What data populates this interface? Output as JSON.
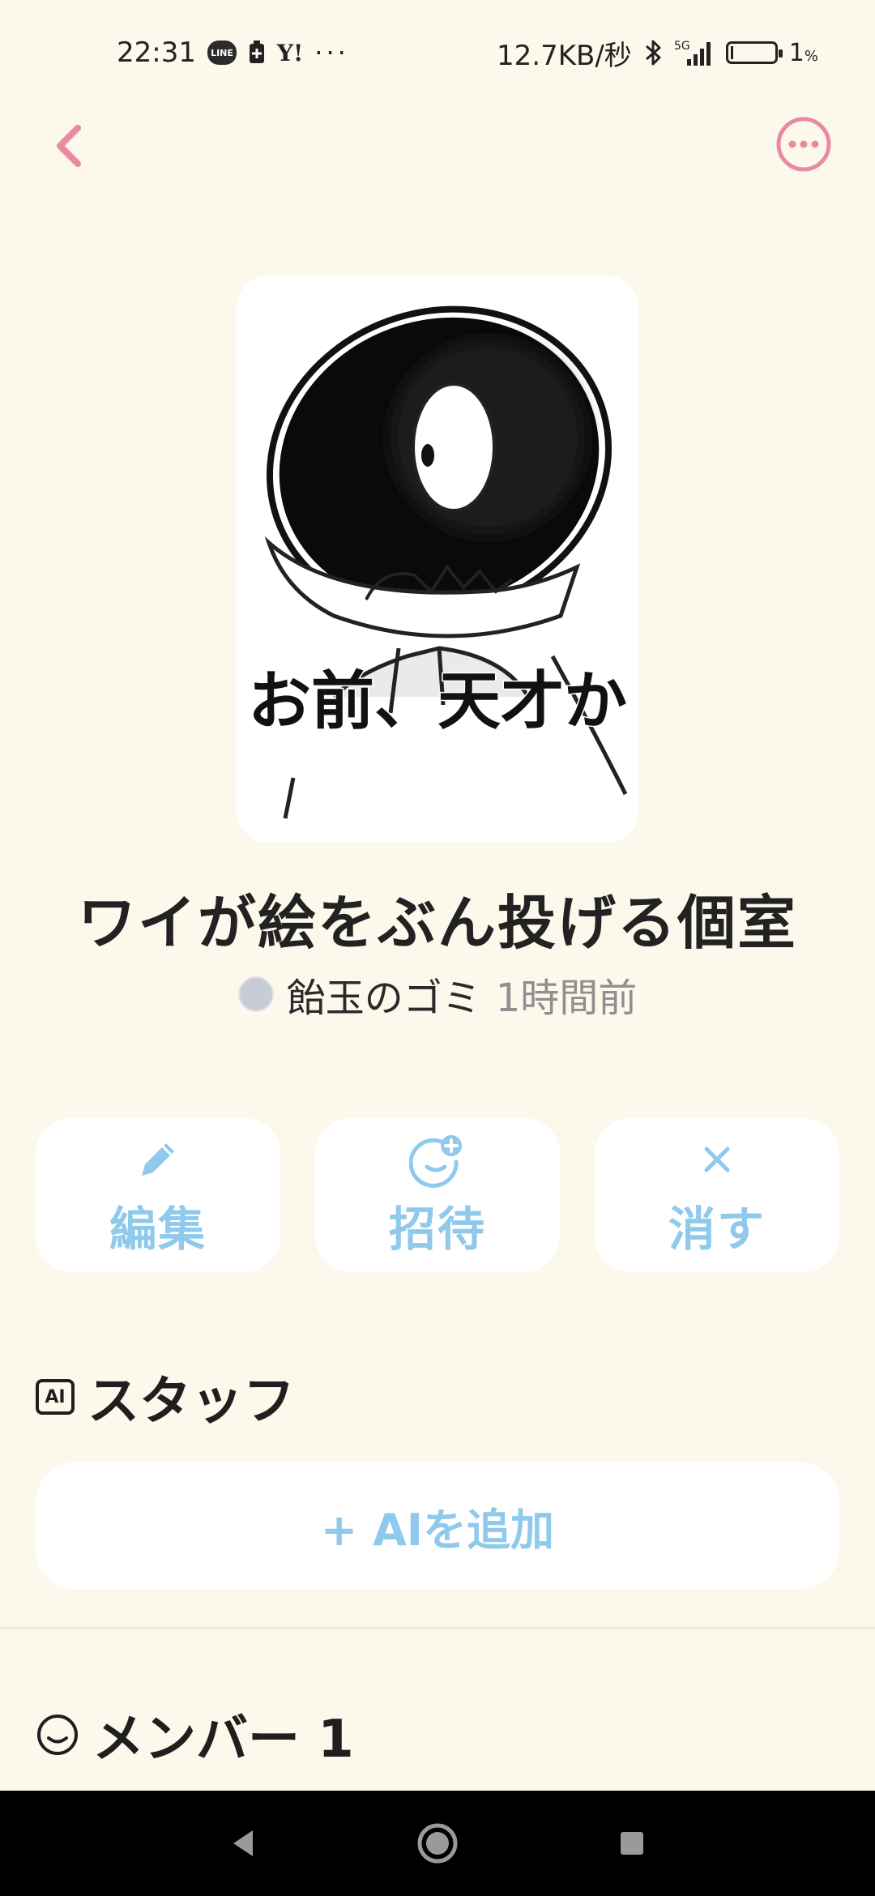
{
  "status_bar": {
    "time": "22:31",
    "line_badge": "LINE",
    "yahoo": "Y!",
    "more_dots": "···",
    "net_speed": "12.7KB/秒",
    "network": "5G",
    "battery_percent": "1",
    "battery_unit": "%",
    "battery_level": 0.01
  },
  "header": {
    "back_icon": "chevron-left-icon",
    "more_icon": "more-horizontal-icon",
    "accent_color": "#e98aa0"
  },
  "room": {
    "cover_caption": "お前、天才か",
    "title": "ワイが絵をぶん投げる個室",
    "author": "飴玉のゴミ",
    "time_ago": "1時間前"
  },
  "actions": [
    {
      "label": "編集",
      "icon": "pencil-icon"
    },
    {
      "label": "招待",
      "icon": "add-person-icon"
    },
    {
      "label": "消す",
      "icon": "close-icon"
    }
  ],
  "staff": {
    "icon_text": "AI",
    "heading": "スタッフ",
    "add_label": "+ AIを追加"
  },
  "members": {
    "heading": "メンバー 1",
    "icon": "smile-face-icon"
  },
  "colors": {
    "background": "#fdf8ec",
    "action_blue": "#8fc9ec",
    "accent_pink": "#e98aa0"
  }
}
